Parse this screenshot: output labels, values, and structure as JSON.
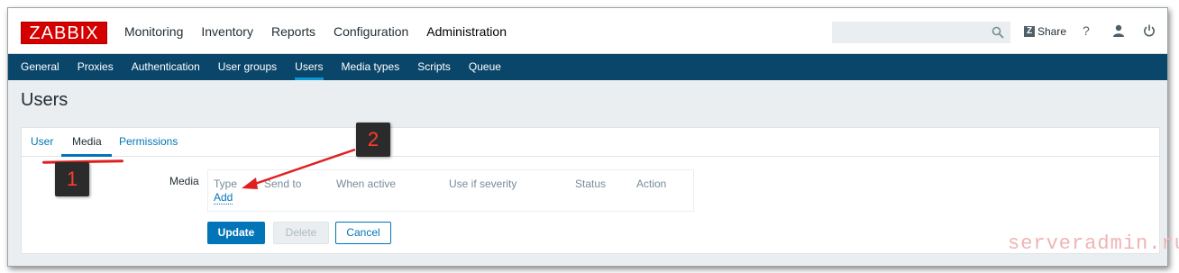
{
  "header": {
    "logo": "ZABBIX",
    "menu": [
      "Monitoring",
      "Inventory",
      "Reports",
      "Configuration",
      "Administration"
    ],
    "active_menu": "Administration",
    "search_placeholder": "",
    "share_label": "Share",
    "help_label": "?"
  },
  "subnav": {
    "items": [
      "General",
      "Proxies",
      "Authentication",
      "User groups",
      "Users",
      "Media types",
      "Scripts",
      "Queue"
    ],
    "active": "Users"
  },
  "page": {
    "title": "Users"
  },
  "tabs": {
    "user": "User",
    "media": "Media",
    "permissions": "Permissions"
  },
  "media": {
    "label": "Media",
    "columns": {
      "type": "Type",
      "send_to": "Send to",
      "when_active": "When active",
      "use_if_severity": "Use if severity",
      "status": "Status",
      "action": "Action"
    },
    "add_link": "Add"
  },
  "buttons": {
    "update": "Update",
    "delete": "Delete",
    "cancel": "Cancel"
  },
  "annotations": {
    "badge_1": "1",
    "badge_2": "2"
  },
  "watermark": "serveradmin.ru",
  "colors": {
    "brand_red": "#d40000",
    "nav_blue": "#0a466a",
    "link_blue": "#0275b8",
    "annotation_red": "#e02020"
  }
}
